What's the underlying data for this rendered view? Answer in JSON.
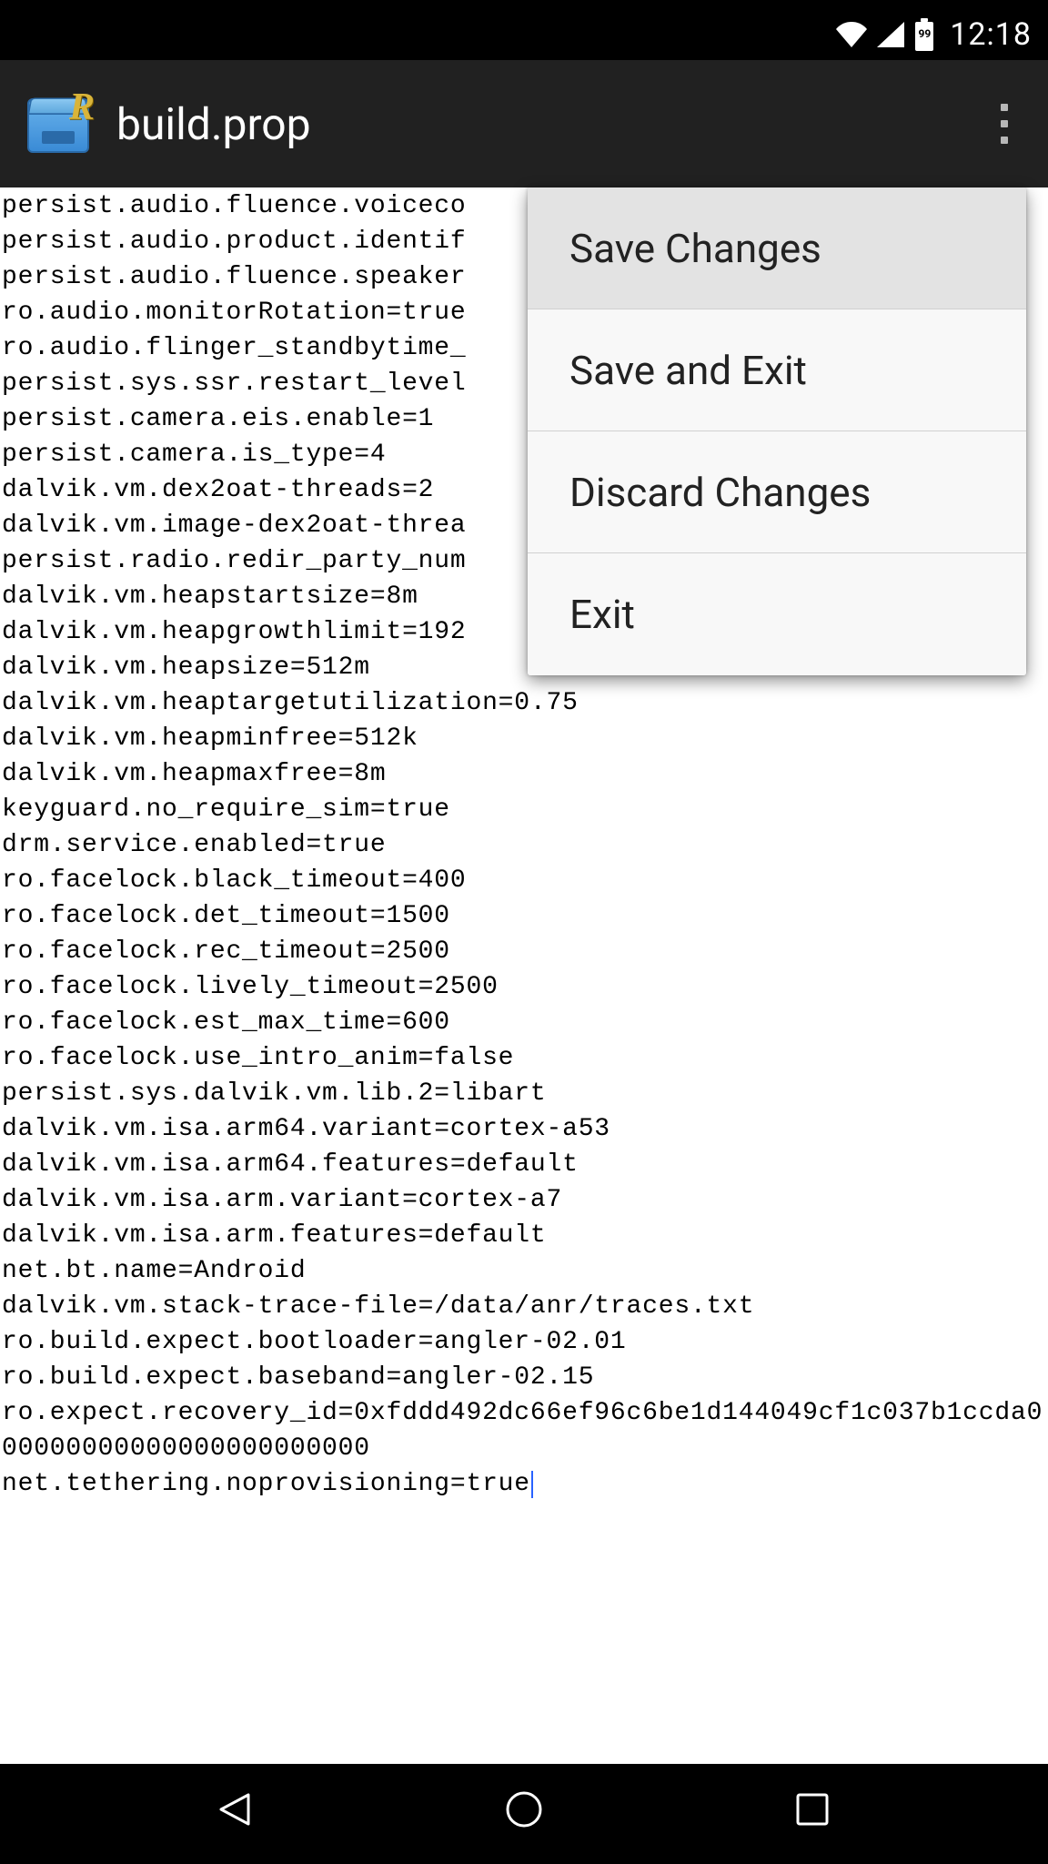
{
  "status_bar": {
    "battery_level": "99",
    "clock": "12:18"
  },
  "action_bar": {
    "title": "build.prop"
  },
  "menu": {
    "items": [
      {
        "label": "Save Changes"
      },
      {
        "label": "Save and Exit"
      },
      {
        "label": "Discard Changes"
      },
      {
        "label": "Exit"
      }
    ]
  },
  "editor": {
    "lines": [
      "persist.audio.fluence.voiceco",
      "persist.audio.product.identif",
      "persist.audio.fluence.speaker",
      "ro.audio.monitorRotation=true",
      "ro.audio.flinger_standbytime_",
      "persist.sys.ssr.restart_level",
      "persist.camera.eis.enable=1",
      "persist.camera.is_type=4",
      "dalvik.vm.dex2oat-threads=2",
      "dalvik.vm.image-dex2oat-threa",
      "persist.radio.redir_party_num",
      "dalvik.vm.heapstartsize=8m",
      "dalvik.vm.heapgrowthlimit=192",
      "dalvik.vm.heapsize=512m",
      "dalvik.vm.heaptargetutilization=0.75",
      "dalvik.vm.heapminfree=512k",
      "dalvik.vm.heapmaxfree=8m",
      "keyguard.no_require_sim=true",
      "drm.service.enabled=true",
      "ro.facelock.black_timeout=400",
      "ro.facelock.det_timeout=1500",
      "ro.facelock.rec_timeout=2500",
      "ro.facelock.lively_timeout=2500",
      "ro.facelock.est_max_time=600",
      "ro.facelock.use_intro_anim=false",
      "persist.sys.dalvik.vm.lib.2=libart",
      "dalvik.vm.isa.arm64.variant=cortex-a53",
      "dalvik.vm.isa.arm64.features=default",
      "dalvik.vm.isa.arm.variant=cortex-a7",
      "dalvik.vm.isa.arm.features=default",
      "net.bt.name=Android",
      "dalvik.vm.stack-trace-file=/data/anr/traces.txt",
      "ro.build.expect.bootloader=angler-02.01",
      "ro.build.expect.baseband=angler-02.15",
      "ro.expect.recovery_id=0xfddd492dc66ef96c6be1d144049cf1c037b1ccda000000000000000000000000",
      "net.tethering.noprovisioning=true"
    ]
  }
}
